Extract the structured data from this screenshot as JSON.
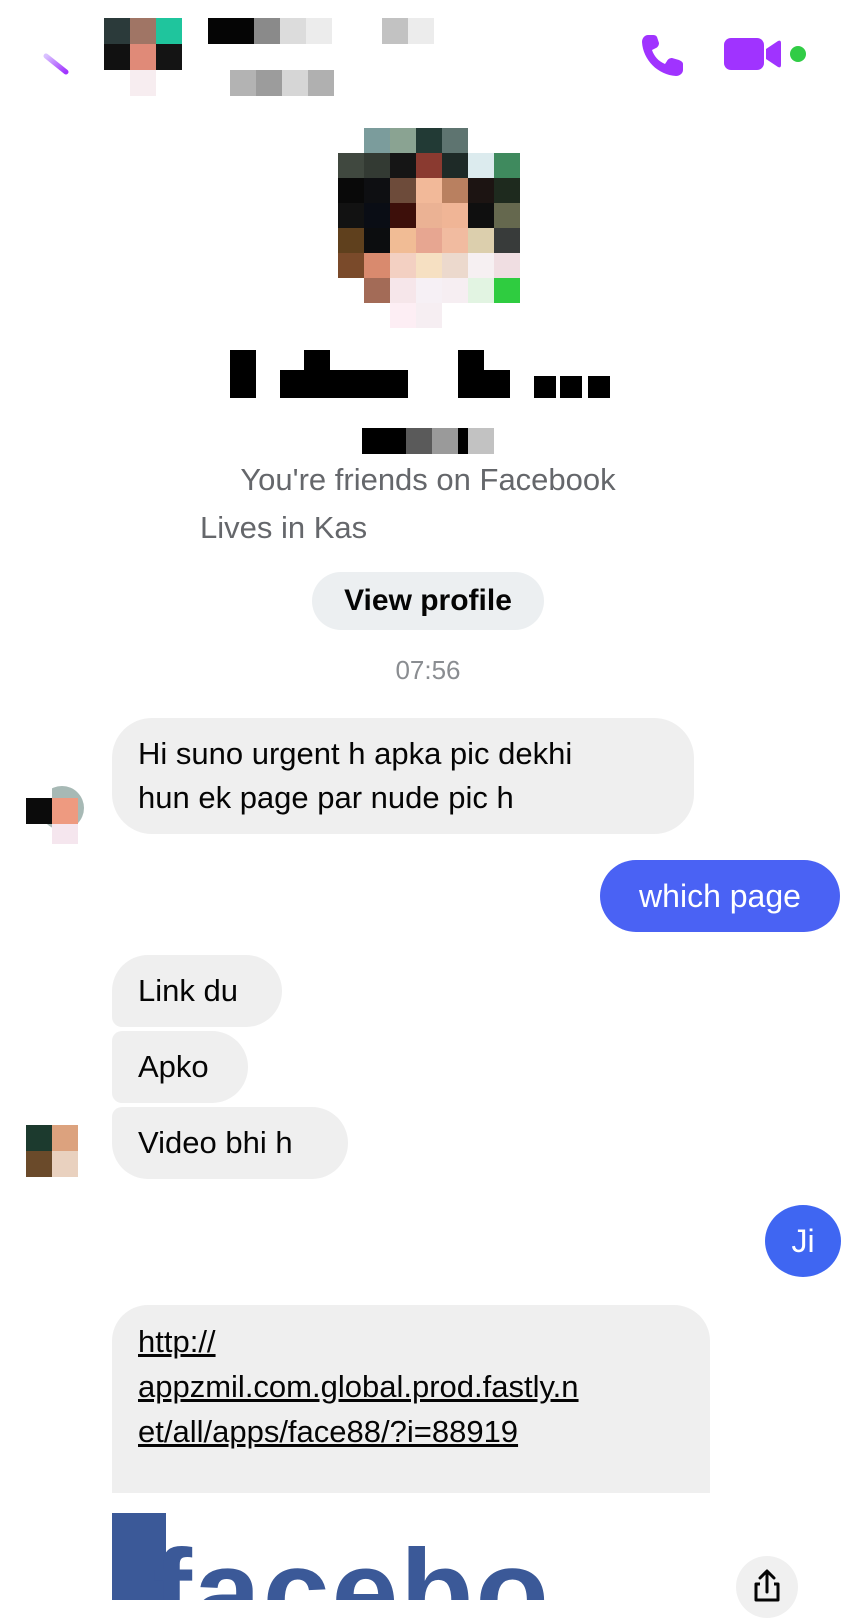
{
  "header": {
    "back_icon": "back-arrow-icon",
    "call_icon": "phone-icon",
    "video_icon": "video-camera-icon",
    "accent_color": "#a033ff",
    "online_color": "#31cc46"
  },
  "profile": {
    "friends_text": "You're friends on Facebook",
    "lives_text": "Lives in Kas",
    "view_profile_label": "View profile"
  },
  "conversation": {
    "timestamp": "07:56",
    "messages": [
      {
        "from": "them",
        "text": "Hi suno urgent h apka pic dekhi\nhun ek page par nude pic h"
      },
      {
        "from": "me",
        "text": "which page"
      },
      {
        "from": "them",
        "text": "Link du"
      },
      {
        "from": "them",
        "text": "Apko"
      },
      {
        "from": "them",
        "text": "Video bhi h"
      },
      {
        "from": "me",
        "text": "Ji"
      },
      {
        "from": "them",
        "text": "http://\nappzmil.com.global.prod.fastly.n\net/all/apps/face88/?i=88919"
      }
    ],
    "link_preview_text": "facebo",
    "share_icon": "share-icon",
    "outgoing_color": "#4a62f4"
  }
}
